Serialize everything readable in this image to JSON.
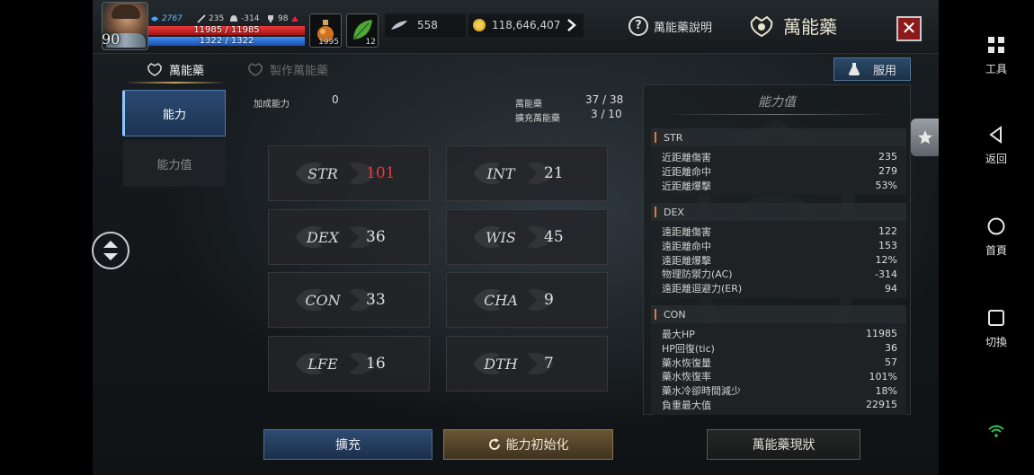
{
  "hud": {
    "level": "90",
    "stat_shield": "2767",
    "stat_attack": "235",
    "stat_ac": "-314",
    "stat_trophy": "98",
    "hp_text": "11985 / 11985",
    "mp_text": "1322 / 1322",
    "hp_fraction": 1.0,
    "mp_fraction": 1.0,
    "potion_count": "1995",
    "herb_count": "12",
    "feather_count": "558",
    "gold_amount": "118,646,407",
    "help_label": "萬能藥說明",
    "title": "萬能藥",
    "close_label": "✕"
  },
  "tabs": [
    {
      "label": "萬能藥",
      "active": true
    },
    {
      "label": "製作萬能藥",
      "active": false
    }
  ],
  "use_button": "服用",
  "side_menu": [
    {
      "label": "能力",
      "active": true
    },
    {
      "label": "能力值",
      "active": false
    }
  ],
  "info": {
    "bonus_label": "加成能力",
    "bonus_value": "0",
    "elixir_label": "萬能藥",
    "elixir_value": "37 / 38",
    "expand_label": "擴充萬能藥",
    "expand_value": "3 / 10"
  },
  "stats": [
    {
      "name": "STR",
      "value": "101",
      "highlight": true
    },
    {
      "name": "INT",
      "value": "21",
      "highlight": false
    },
    {
      "name": "DEX",
      "value": "36",
      "highlight": false
    },
    {
      "name": "WIS",
      "value": "45",
      "highlight": false
    },
    {
      "name": "CON",
      "value": "33",
      "highlight": false
    },
    {
      "name": "CHA",
      "value": "9",
      "highlight": false
    },
    {
      "name": "LFE",
      "value": "16",
      "highlight": false
    },
    {
      "name": "DTH",
      "value": "7",
      "highlight": false
    }
  ],
  "panel": {
    "title": "能力值",
    "groups": [
      {
        "name": "STR",
        "rows": [
          {
            "label": "近距離傷害",
            "value": "235"
          },
          {
            "label": "近距離命中",
            "value": "279"
          },
          {
            "label": "近距離爆擊",
            "value": "53%"
          }
        ]
      },
      {
        "name": "DEX",
        "rows": [
          {
            "label": "遠距離傷害",
            "value": "122"
          },
          {
            "label": "遠距離命中",
            "value": "153"
          },
          {
            "label": "遠距離爆擊",
            "value": "12%"
          },
          {
            "label": "物理防禦力(AC)",
            "value": "-314"
          },
          {
            "label": "遠距離迴避力(ER)",
            "value": "94"
          }
        ]
      },
      {
        "name": "CON",
        "rows": [
          {
            "label": "最大HP",
            "value": "11985"
          },
          {
            "label": "HP回復(tic)",
            "value": "36"
          },
          {
            "label": "藥水恢復量",
            "value": "57"
          },
          {
            "label": "藥水恢復率",
            "value": "101%"
          },
          {
            "label": "藥水冷卻時間減少",
            "value": "18%"
          },
          {
            "label": "負重最大值",
            "value": "22915"
          }
        ]
      }
    ]
  },
  "bottom": {
    "expand": "擴充",
    "reset": "能力初始化",
    "status": "萬能藥現狀"
  },
  "nav": {
    "tools": "工具",
    "back": "返回",
    "home": "首頁",
    "switch": "切換"
  },
  "colors": {
    "highlight_red": "#e8393c",
    "blue_button": "#2e4c72",
    "gold_button": "#6b5636",
    "orange_accent": "#e07b39"
  }
}
